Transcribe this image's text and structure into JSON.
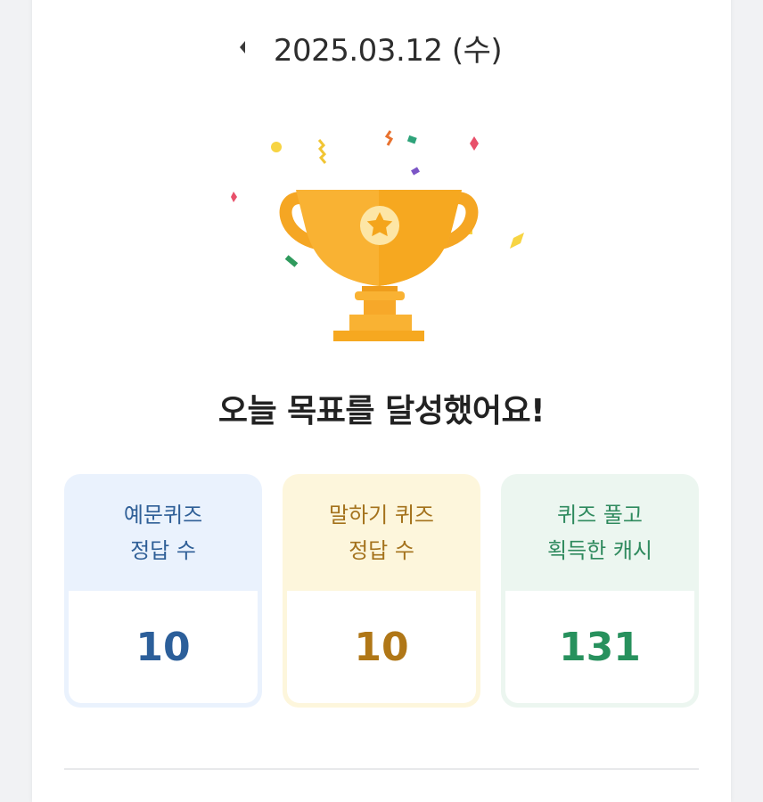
{
  "header": {
    "date": "2025.03.12 (수)",
    "prev_icon": "caret-left-icon"
  },
  "main": {
    "headline": "오늘 목표를 달성했어요!",
    "trophy_icon": "trophy-icon"
  },
  "stats": [
    {
      "label_line1": "예문퀴즈",
      "label_line2": "정답 수",
      "value": "10",
      "color": "#2c5f9a"
    },
    {
      "label_line1": "말하기 퀴즈",
      "label_line2": "정답 수",
      "value": "10",
      "color": "#b07717"
    },
    {
      "label_line1": "퀴즈 풀고",
      "label_line2": "획득한 캐시",
      "value": "131",
      "color": "#27915d"
    }
  ],
  "colors": {
    "trophy": "#f9b233",
    "trophy_dark": "#ef9d1c",
    "background": "#ffffff"
  }
}
